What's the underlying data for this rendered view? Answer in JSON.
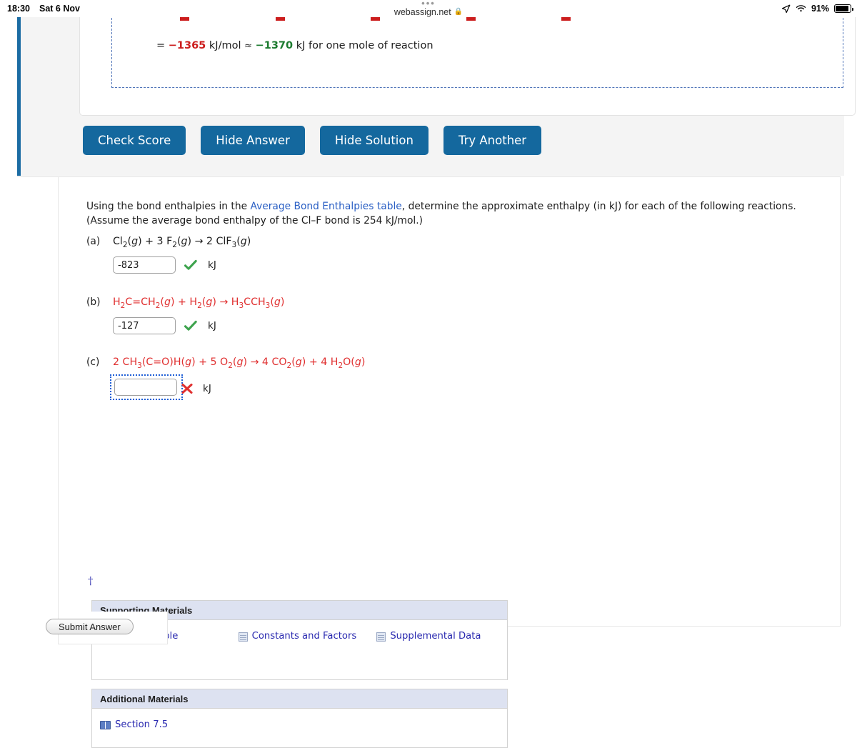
{
  "status_bar": {
    "time": "18:30",
    "date": "Sat 6 Nov",
    "battery_percent": "91%",
    "icons": [
      "location-arrow-icon",
      "wifi-icon",
      "battery-icon"
    ]
  },
  "browser": {
    "tab_title": "webassign.net",
    "lock_icon": "lock-icon",
    "tab_overflow_icon": "three-dots-icon"
  },
  "solution_panel": {
    "equation_prefix": "=",
    "value_1": "−1365",
    "unit_1": "kJ/mol",
    "approx_symbol": "≈",
    "value_2": "−1370",
    "unit_2": "kJ",
    "trailing_text": "for one mole of reaction"
  },
  "toolbar": {
    "buttons": [
      {
        "label": "Check Score",
        "name": "check-score-button"
      },
      {
        "label": "Hide Answer",
        "name": "hide-answer-button"
      },
      {
        "label": "Hide Solution",
        "name": "hide-solution-button"
      },
      {
        "label": "Try Another",
        "name": "try-another-button"
      }
    ]
  },
  "question": {
    "prompt_part1": "Using the bond enthalpies in the ",
    "prompt_link": "Average Bond Enthalpies table",
    "prompt_part2": ", determine the approximate enthalpy (in kJ) for each of the following reactions. (Assume the average bond enthalpy of the Cl–F bond is 254 kJ/mol.)",
    "parts": [
      {
        "label": "(a)",
        "equation_text": "Cl2(g) + 3 F2(g) → 2 ClF3(g)",
        "equation_color": "black",
        "answer_value": "-823",
        "unit": "kJ",
        "status": "correct",
        "status_icon": "green-check-icon",
        "focused": false
      },
      {
        "label": "(b)",
        "equation_text": "H2C=CH2(g) + H2(g) → H3CCH3(g)",
        "equation_color": "red",
        "answer_value": "-127",
        "unit": "kJ",
        "status": "correct",
        "status_icon": "green-check-icon",
        "focused": false
      },
      {
        "label": "(c)",
        "equation_text": "2 CH3(C=O)H(g) + 5 O2(g) → 4 CO2(g) + 4 H2O(g)",
        "equation_color": "red",
        "answer_value": "",
        "unit": "kJ",
        "status": "incorrect",
        "status_icon": "red-x-icon",
        "focused": true
      }
    ],
    "footnote_symbol": "†"
  },
  "supporting_materials": {
    "title": "Supporting Materials",
    "links": [
      {
        "label": "Periodic Table",
        "icon": "spreadsheet-icon"
      },
      {
        "label": "Constants and Factors",
        "icon": "spreadsheet-icon"
      },
      {
        "label": "Supplemental Data",
        "icon": "spreadsheet-icon"
      }
    ]
  },
  "additional_materials": {
    "title": "Additional Materials",
    "links": [
      {
        "label": "Section 7.5",
        "icon": "book-icon"
      }
    ]
  },
  "submit": {
    "label": "Submit Answer"
  },
  "colors": {
    "accent_blue": "#14689e",
    "sidebar_bar": "#1b6ca3",
    "link_blue": "#2a5fc4",
    "material_link": "#2a2ab0",
    "header_bg": "#dde2f1",
    "correct_green": "#3da34d",
    "incorrect_red": "#e03030",
    "equation_red": "#e03030",
    "value_red": "#cc1d1d",
    "value_green": "#1b7a2e"
  }
}
